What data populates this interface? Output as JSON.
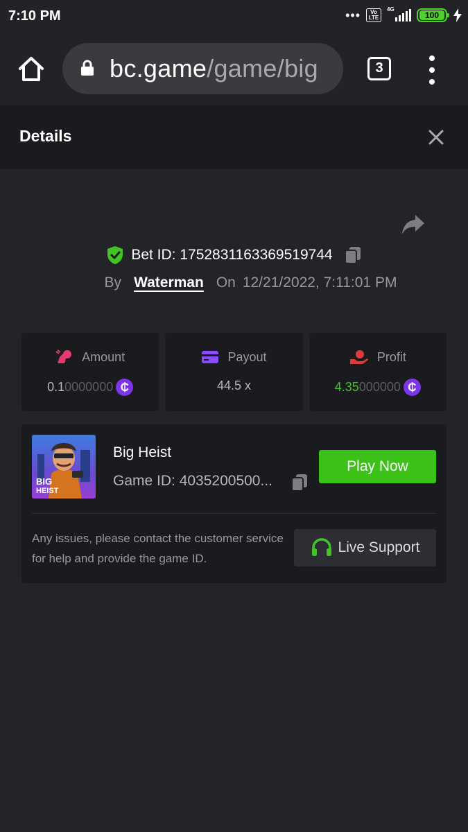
{
  "status_bar": {
    "time": "7:10 PM",
    "volte_label": "Vo LTE",
    "network_label": "4G",
    "battery_level": "100"
  },
  "browser": {
    "url_host": "bc.game",
    "url_path": "/game/big",
    "tab_count": "3"
  },
  "panel": {
    "title": "Details"
  },
  "bet": {
    "bet_id_label": "Bet ID: 1752831163369519744",
    "by_label": "By",
    "username": "Waterman",
    "on_label": "On",
    "datetime": "12/21/2022, 7:11:01 PM"
  },
  "stats": {
    "amount_label": "Amount",
    "amount_main": "0.1",
    "amount_trailing": "0000000",
    "payout_label": "Payout",
    "payout_value": "44.5 x",
    "profit_label": "Profit",
    "profit_main": "4.35",
    "profit_trailing": "000000",
    "coin_symbol": "₵"
  },
  "game": {
    "name": "Big Heist",
    "thumb_text_line1": "BIG",
    "thumb_text_line2": "HEIST",
    "game_id_label": "Game ID: 4035200500...",
    "play_label": "Play Now",
    "help_text": "Any issues, please contact the customer service for help and provide the game ID.",
    "support_label": "Live Support"
  },
  "colors": {
    "accent_green": "#3bc117",
    "profit_green": "#42c524",
    "coin_purple": "#7c35e8",
    "amount_pink": "#e63a6c",
    "payout_purple": "#8a4bff",
    "profit_red": "#e0393b"
  },
  "icons": [
    "home-icon",
    "lock-icon",
    "tabs-icon",
    "more-vert-icon",
    "close-icon",
    "share-icon",
    "shield-check-icon",
    "copy-icon",
    "amount-icon",
    "payout-card-icon",
    "profit-hand-icon",
    "coin-icon",
    "headset-icon"
  ]
}
